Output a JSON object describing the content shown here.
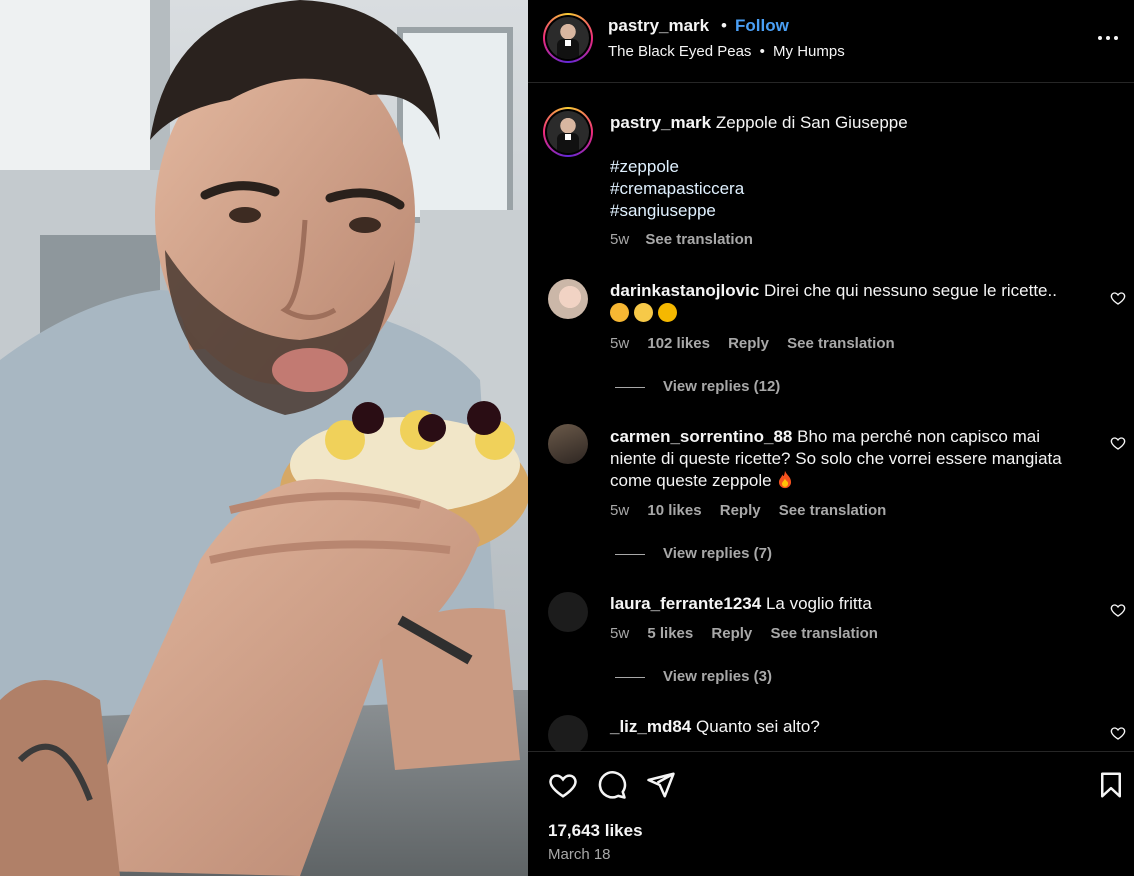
{
  "header": {
    "username": "pastry_mark",
    "separator": "•",
    "follow_label": "Follow",
    "audio_artist": "The Black Eyed Peas",
    "audio_separator": "•",
    "audio_track": "My Humps",
    "more_icon": "more-horizontal-icon"
  },
  "caption": {
    "username": "pastry_mark",
    "text": "Zeppole di San Giuseppe",
    "hashtags": [
      "#zeppole",
      "#cremapasticcera",
      "#sangiuseppe"
    ],
    "age": "5w",
    "translate_label": "See translation"
  },
  "comments": [
    {
      "username": "darinkastanojlovic",
      "text": "Direi che qui nessuno segue le ricette..",
      "emojis": [
        "smiling-face-with-hearts",
        "upside-down-face",
        "rolling-on-floor-laughing"
      ],
      "age": "5w",
      "likes": "102 likes",
      "reply_label": "Reply",
      "translate_label": "See translation",
      "view_replies": "View replies (12)"
    },
    {
      "username": "carmen_sorrentino_88",
      "text_line1": "Bho ma perché non capisco mai",
      "text_line2": "niente di queste ricette? So solo che vorrei essere mangiata",
      "text_line3": "come queste zeppole",
      "emoji": "fire",
      "age": "5w",
      "likes": "10 likes",
      "reply_label": "Reply",
      "translate_label": "See translation",
      "view_replies": "View replies (7)"
    },
    {
      "username": "laura_ferrante1234",
      "text": "La voglio fritta",
      "age": "5w",
      "likes": "5 likes",
      "reply_label": "Reply",
      "translate_label": "See translation",
      "view_replies": "View replies (3)"
    },
    {
      "username": "_liz_md84",
      "text": "Quanto sei alto?"
    }
  ],
  "footer": {
    "likes": "17,643 likes",
    "date": "March 18"
  },
  "colors": {
    "background": "#000000",
    "text": "#f5f5f5",
    "muted": "#a8a8a8",
    "link": "#4a9ff5",
    "divider": "#262626"
  }
}
